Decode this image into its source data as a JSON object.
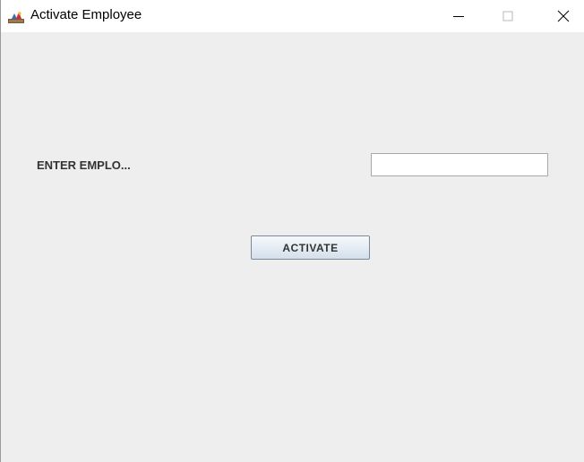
{
  "window": {
    "title": "Activate Employee",
    "app_icon": "java-cup-icon",
    "controls": {
      "minimize_icon": "minimize-icon",
      "maximize_icon": "maximize-icon",
      "close_icon": "close-icon"
    }
  },
  "form": {
    "employee_label": "ENTER EMPLO...",
    "employee_input_value": "",
    "activate_button_label": "ACTIVATE"
  },
  "colors": {
    "content_background": "#eeeeee",
    "titlebar_background": "#ffffff",
    "button_border": "#7a8a99"
  }
}
